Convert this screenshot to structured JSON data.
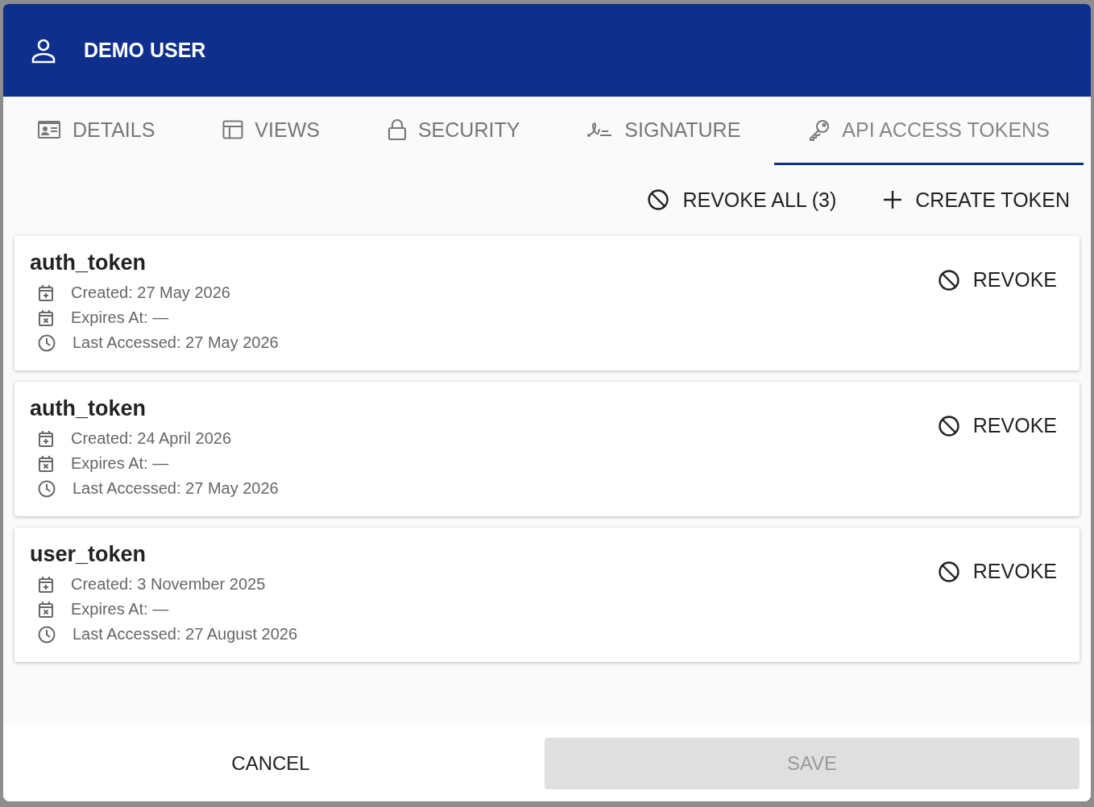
{
  "dialog": {
    "title": "DEMO USER"
  },
  "tabs": [
    {
      "label": "DETAILS",
      "selected": false
    },
    {
      "label": "VIEWS",
      "selected": false
    },
    {
      "label": "SECURITY",
      "selected": false
    },
    {
      "label": "SIGNATURE",
      "selected": false
    },
    {
      "label": "API ACCESS TOKENS",
      "selected": true
    }
  ],
  "actions": {
    "revoke_all": "REVOKE ALL (3)",
    "create": "CREATE TOKEN"
  },
  "tokens": [
    {
      "name": "auth_token",
      "created": "Created: 27 May 2026",
      "expires": "Expires At: —",
      "last_accessed": "Last Accessed: 27 May 2026",
      "revoke": "REVOKE"
    },
    {
      "name": "auth_token",
      "created": "Created: 24 April 2026",
      "expires": "Expires At: —",
      "last_accessed": "Last Accessed: 27 May 2026",
      "revoke": "REVOKE"
    },
    {
      "name": "user_token",
      "created": "Created: 3 November 2025",
      "expires": "Expires At: —",
      "last_accessed": "Last Accessed: 27 August 2026",
      "revoke": "REVOKE"
    }
  ],
  "footer": [
    {
      "label": "CANCEL",
      "disabled": false
    },
    {
      "label": "SAVE",
      "disabled": true
    }
  ]
}
